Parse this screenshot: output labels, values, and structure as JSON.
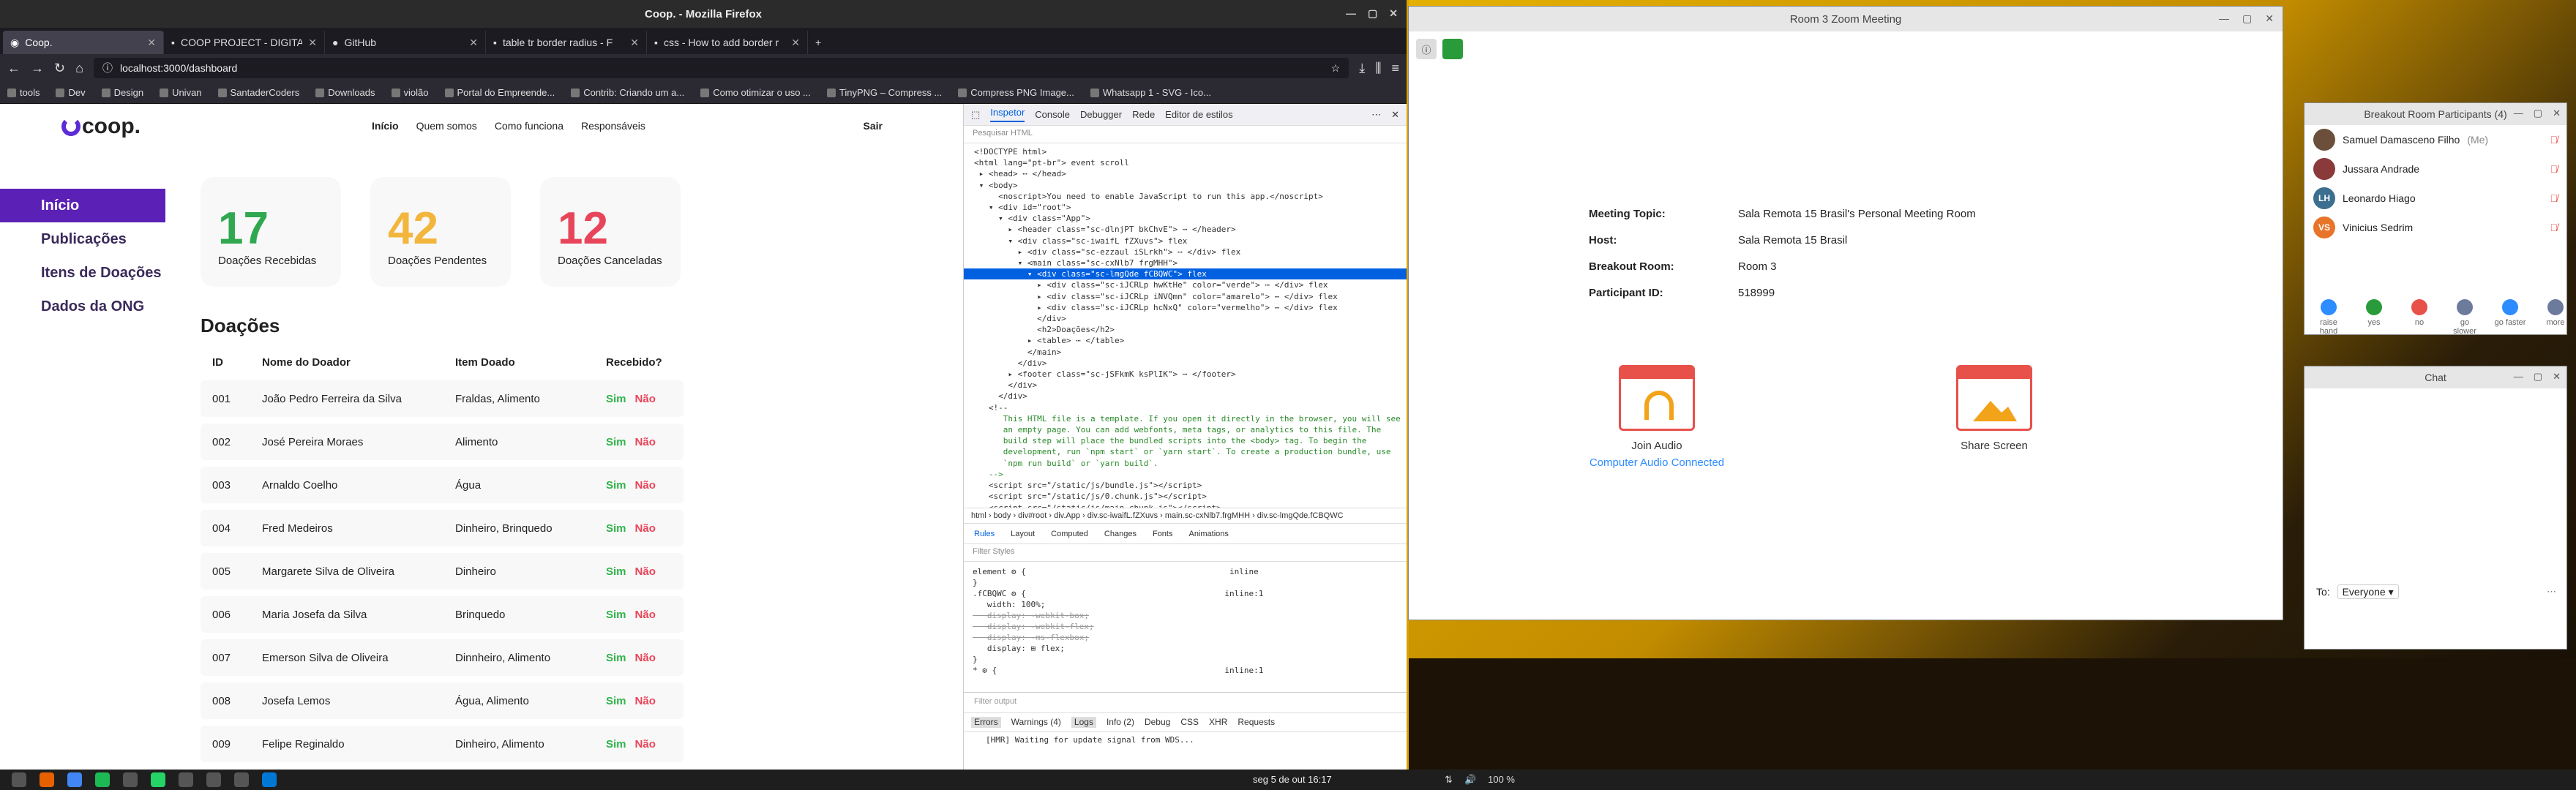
{
  "firefox": {
    "window_title": "Coop. - Mozilla Firefox",
    "tabs": [
      {
        "label": "Coop.",
        "active": true
      },
      {
        "label": "COOP PROJECT - DIGITA"
      },
      {
        "label": "GitHub"
      },
      {
        "label": "table tr border radius - F"
      },
      {
        "label": "css - How to add border r"
      }
    ],
    "new_tab": "+",
    "url": "localhost:3000/dashboard",
    "bookmarks": [
      "tools",
      "Dev",
      "Design",
      "Univan",
      "SantaderCoders",
      "Downloads",
      "violão",
      "Portal do Empreende...",
      "Contrib: Criando um a...",
      "Como otimizar o uso ...",
      "TinyPNG – Compress ...",
      "Compress PNG Image...",
      "Whatsapp 1 - SVG - Ico..."
    ]
  },
  "site": {
    "logo": "coop.",
    "nav": [
      "Início",
      "Quem somos",
      "Como funciona",
      "Responsáveis"
    ],
    "logout": "Sair",
    "sidebar": [
      "Início",
      "Publicações",
      "Itens de Doações",
      "Dados da ONG"
    ],
    "cards": [
      {
        "value": "17",
        "label": "Doações Recebidas",
        "color": "#2fa84f"
      },
      {
        "value": "42",
        "label": "Doações Pendentes",
        "color": "#f2b63c"
      },
      {
        "value": "12",
        "label": "Doações Canceladas",
        "color": "#e8455a"
      }
    ],
    "section_title": "Doações",
    "table_headers": [
      "ID",
      "Nome do Doador",
      "Item Doado",
      "Recebido?"
    ],
    "yes": "Sim",
    "no": "Não",
    "rows": [
      {
        "id": "001",
        "name": "João Pedro Ferreira da Silva",
        "item": "Fraldas, Alimento"
      },
      {
        "id": "002",
        "name": "José Pereira Moraes",
        "item": "Alimento"
      },
      {
        "id": "003",
        "name": "Arnaldo Coelho",
        "item": "Água"
      },
      {
        "id": "004",
        "name": "Fred Medeiros",
        "item": "Dinheiro, Brinquedo"
      },
      {
        "id": "005",
        "name": "Margarete Silva de Oliveira",
        "item": "Dinheiro"
      },
      {
        "id": "006",
        "name": "Maria Josefa da Silva",
        "item": "Brinquedo"
      },
      {
        "id": "007",
        "name": "Emerson Silva de Oliveira",
        "item": "Dinnheiro, Alimento"
      },
      {
        "id": "008",
        "name": "Josefa Lemos",
        "item": "Água, Alimento"
      },
      {
        "id": "009",
        "name": "Felipe Reginaldo",
        "item": "Dinheiro, Alimento"
      }
    ]
  },
  "devtools": {
    "tabs": [
      "Inspetor",
      "Console",
      "Debugger",
      "Rede",
      "Editor de estilos"
    ],
    "search_placeholder": "Pesquisar HTML",
    "breadcrumbs": "html › body › div#root › div.App › div.sc-iwaifL.fZXuvs › main.sc-cxNlb7.frgMHH › div.sc-lmgQde.fCBQWC",
    "rule_tabs": [
      "Rules",
      "Layout",
      "Computed",
      "Changes",
      "Fonts",
      "Animations"
    ],
    "filter_styles": "Filter Styles",
    "console_filter": "Filter output",
    "console_tabs": [
      "Errors",
      "Warnings (4)",
      "Logs",
      "Info (2)",
      "Debug",
      "CSS",
      "XHR",
      "Requests"
    ],
    "console_msg": "[HMR] Waiting for update signal from WDS..."
  },
  "zoom": {
    "title": "Room 3  Zoom Meeting",
    "info": [
      {
        "k": "Meeting Topic:",
        "v": "Sala Remota 15 Brasil's Personal Meeting Room"
      },
      {
        "k": "Host:",
        "v": "Sala Remota 15 Brasil"
      },
      {
        "k": "Breakout Room:",
        "v": "Room 3"
      },
      {
        "k": "Participant ID:",
        "v": "518999"
      }
    ],
    "join_audio": "Join Audio",
    "audio_status": "Computer Audio Connected",
    "share_screen": "Share Screen",
    "breakout_title": "Breakout Room Participants (4)",
    "participants": [
      {
        "name": "Samuel Damasceno Filho",
        "suffix": "(Me)",
        "initials": "",
        "color": "#6b4f3a"
      },
      {
        "name": "Jussara Andrade",
        "suffix": "",
        "initials": "",
        "color": "#8a3a3a"
      },
      {
        "name": "Leonardo Hiago",
        "suffix": "",
        "initials": "LH",
        "color": "#3c6e8f"
      },
      {
        "name": "Vinicius Sedrim",
        "suffix": "",
        "initials": "VS",
        "color": "#e8742a"
      }
    ],
    "reactions": [
      "raise hand",
      "yes",
      "no",
      "go slower",
      "go faster",
      "more"
    ],
    "chat_title": "Chat",
    "chat_to": "To:",
    "chat_recipient": "Everyone"
  },
  "taskbar": {
    "clock": "seg 5 de out  16:17",
    "battery": "100 %"
  }
}
